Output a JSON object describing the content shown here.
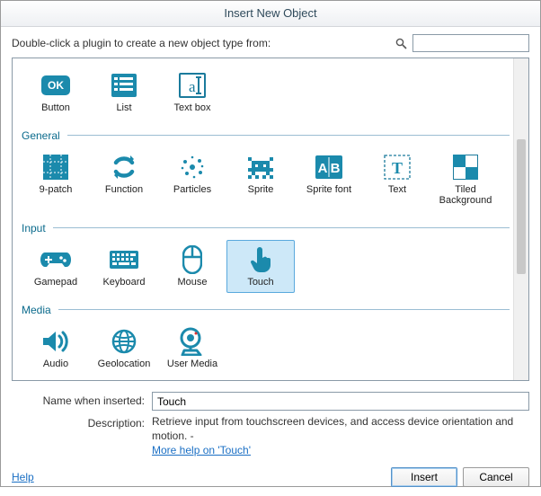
{
  "title": "Insert New Object",
  "instruction": "Double-click a plugin to create a new object type from:",
  "search": {
    "placeholder": ""
  },
  "sections": {
    "top": {
      "label": ""
    },
    "general": {
      "label": "General"
    },
    "input": {
      "label": "Input"
    },
    "media": {
      "label": "Media"
    }
  },
  "plugins": {
    "button": "Button",
    "list": "List",
    "textbox": "Text box",
    "ninepatch": "9-patch",
    "function": "Function",
    "particles": "Particles",
    "sprite": "Sprite",
    "spritefont": "Sprite font",
    "text": "Text",
    "tiledbg": "Tiled Background",
    "gamepad": "Gamepad",
    "keyboard": "Keyboard",
    "mouse": "Mouse",
    "touch": "Touch",
    "audio": "Audio",
    "geolocation": "Geolocation",
    "usermedia": "User Media"
  },
  "form": {
    "name_label": "Name when inserted:",
    "name_value": "Touch",
    "desc_label": "Description:",
    "desc_value": "Retrieve input from touchscreen devices, and access device orientation and motion. - ",
    "more_help": "More help on 'Touch'"
  },
  "footer": {
    "help": "Help",
    "insert": "Insert",
    "cancel": "Cancel"
  },
  "colors": {
    "accent": "#1b7b9c"
  }
}
